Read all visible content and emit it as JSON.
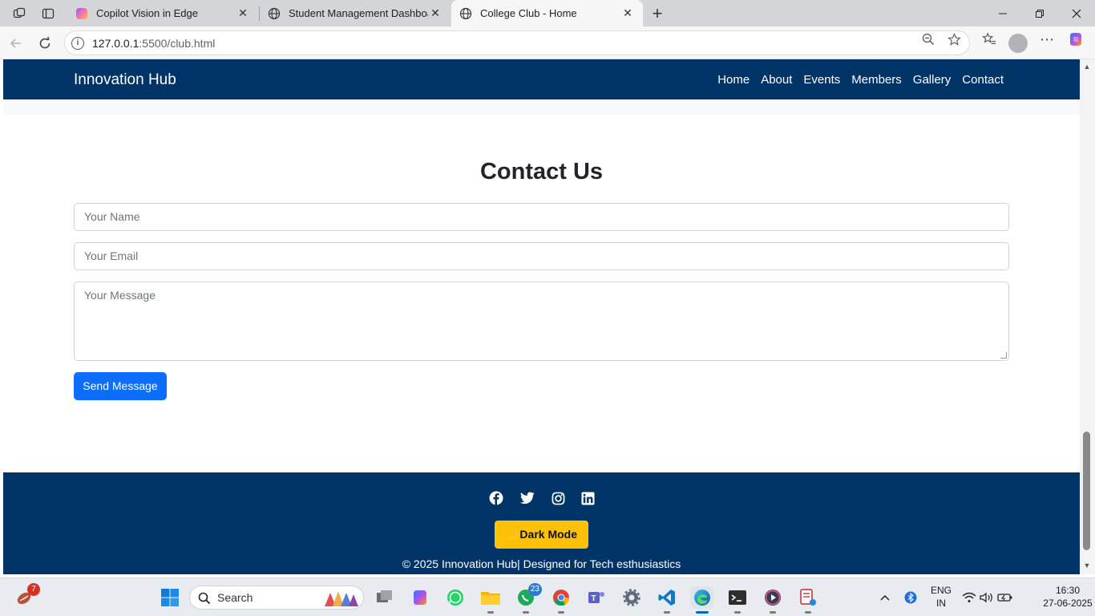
{
  "browser": {
    "tabs": [
      {
        "title": "Copilot Vision in Edge",
        "active": false
      },
      {
        "title": "Student Management Dashboard",
        "active": false
      },
      {
        "title": "College Club - Home",
        "active": true
      }
    ],
    "url_host": "127.0.0.1",
    "url_path": ":5500/club.html"
  },
  "site": {
    "brand": "Innovation Hub",
    "nav": [
      "Home",
      "About",
      "Events",
      "Members",
      "Gallery",
      "Contact"
    ],
    "contact": {
      "title": "Contact Us",
      "name_placeholder": "Your Name",
      "email_placeholder": "Your Email",
      "message_placeholder": "Your Message",
      "send_label": "Send Message"
    },
    "footer": {
      "social_icons": [
        "facebook-icon",
        "twitter-icon",
        "instagram-icon",
        "linkedin-icon"
      ],
      "dark_mode_label": "Dark Mode",
      "dark_mode_icon": "🌙",
      "copyright": "© 2025 Innovation Hub| Designed for Tech esthusiastics"
    },
    "colors": {
      "primary": "#003366",
      "button": "#0d6efd",
      "dark_mode": "#ffc107"
    }
  },
  "taskbar": {
    "search_label": "Search",
    "weather_badge": "7",
    "whatsapp_badge": "23",
    "lang_line1": "ENG",
    "lang_line2": "IN",
    "time": "16:30",
    "date": "27-06-2025"
  }
}
